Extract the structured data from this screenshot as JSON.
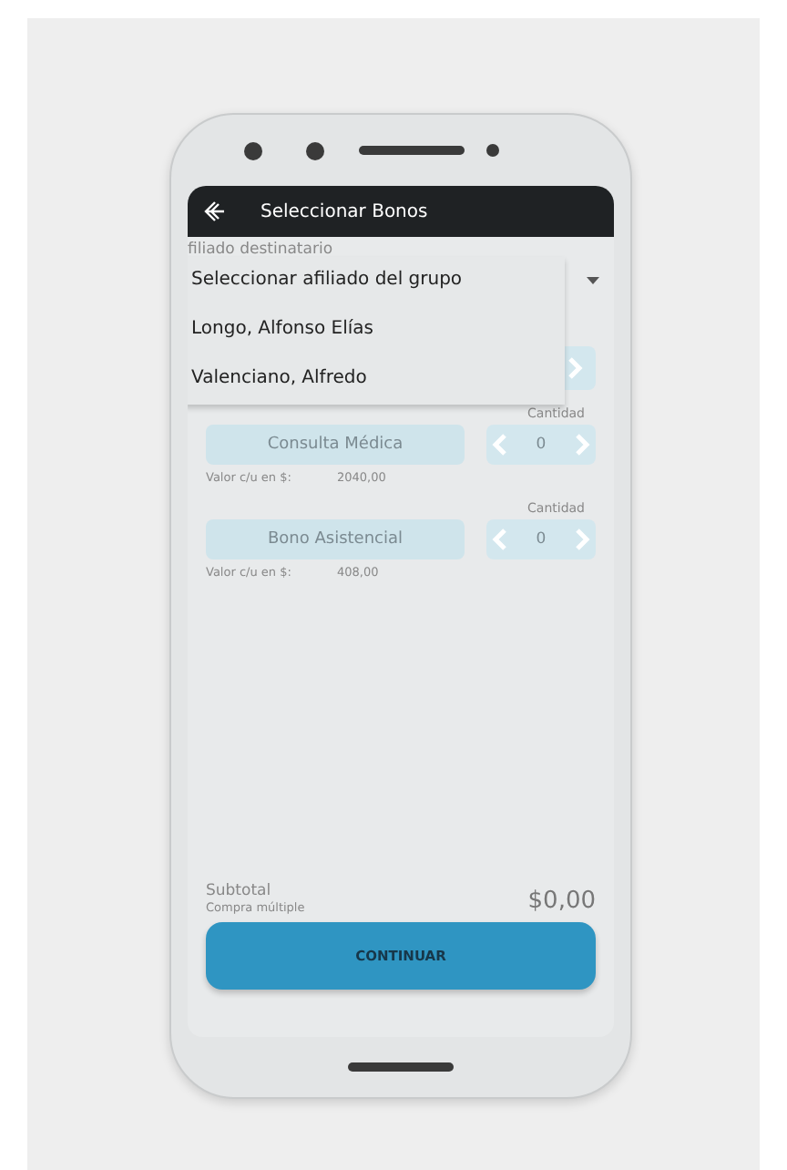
{
  "app_bar": {
    "title": "Seleccionar Bonos"
  },
  "recipient": {
    "label": "filiado destinatario",
    "expanded": true,
    "options": [
      {
        "label": "Seleccionar afiliado del grupo",
        "selected": false
      },
      {
        "label": "Longo, Alfonso Elías",
        "selected": false
      },
      {
        "label": "Valenciano, Alfredo",
        "selected": false
      }
    ]
  },
  "items": [
    {
      "name": "Consulta Médica",
      "quantity_label": "Cantidad",
      "quantity": "0",
      "price_label": "Valor c/u en $:",
      "price": "2040,00"
    },
    {
      "name": "Bono Asistencial",
      "quantity_label": "Cantidad",
      "quantity": "0",
      "price_label": "Valor c/u en $:",
      "price": "408,00"
    }
  ],
  "summary": {
    "label": "Subtotal",
    "sublabel": "Compra múltiple",
    "total": "$0,00"
  },
  "continue_button": "CONTINUAR"
}
